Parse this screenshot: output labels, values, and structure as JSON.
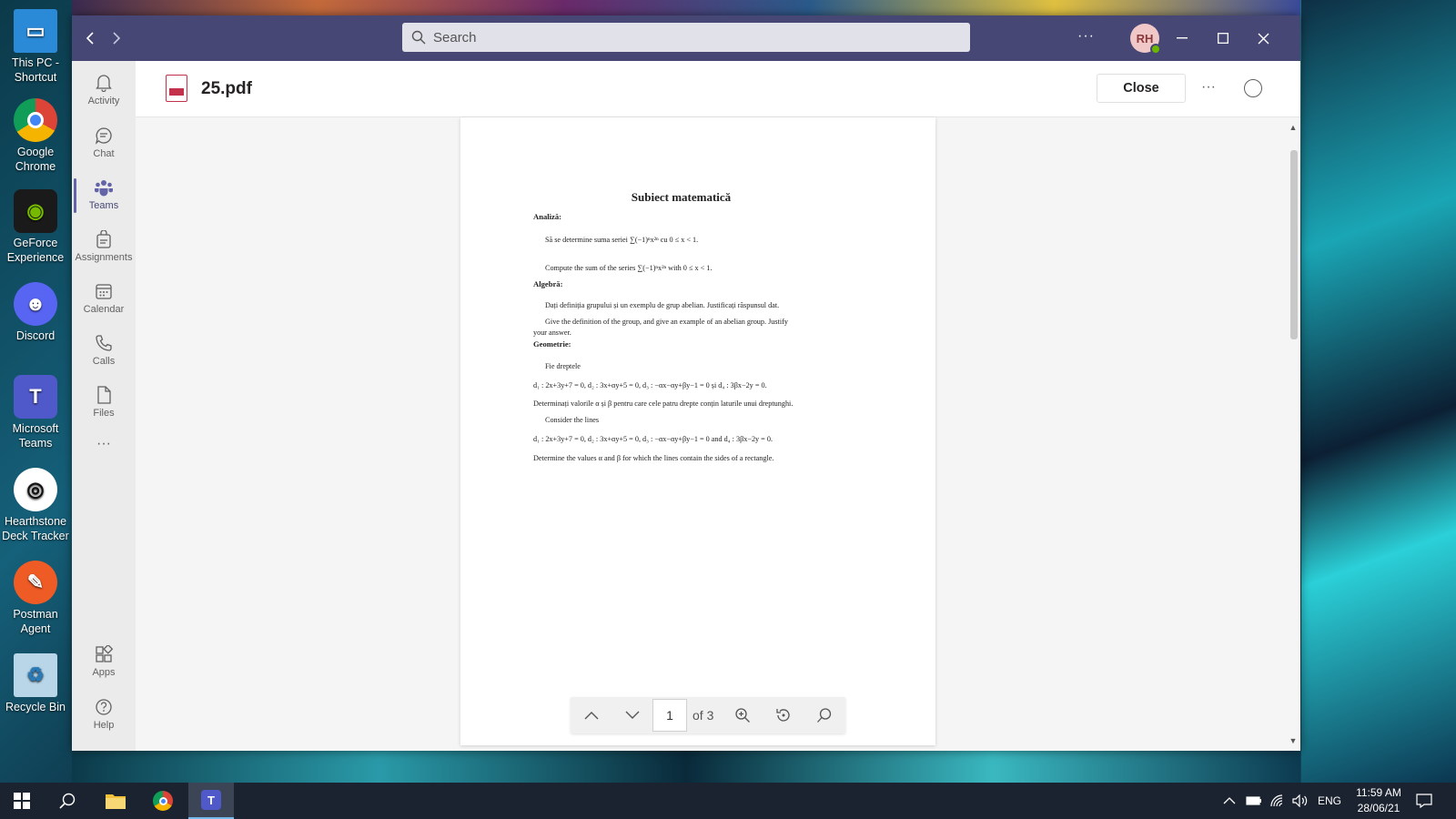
{
  "desktop": {
    "icons": [
      {
        "label": "This PC - Shortcut",
        "icon": "computer-icon"
      },
      {
        "label": "Google Chrome",
        "icon": "chrome-icon"
      },
      {
        "label": "GeForce Experience",
        "icon": "geforce-icon"
      },
      {
        "label": "Discord",
        "icon": "discord-icon"
      },
      {
        "label": "Microsoft Teams",
        "icon": "teams-icon"
      },
      {
        "label": "Hearthstone Deck Tracker",
        "icon": "hearthstone-icon"
      },
      {
        "label": "Postman Agent",
        "icon": "postman-icon"
      },
      {
        "label": "Recycle Bin",
        "icon": "recycle-bin-icon"
      }
    ]
  },
  "titlebar": {
    "search_placeholder": "Search",
    "more": "···",
    "avatar_initials": "RH",
    "accent": "#464775"
  },
  "rail": {
    "items": [
      {
        "label": "Activity",
        "icon": "bell-icon"
      },
      {
        "label": "Chat",
        "icon": "chat-icon"
      },
      {
        "label": "Teams",
        "icon": "teams-icon"
      },
      {
        "label": "Assignments",
        "icon": "assignments-icon"
      },
      {
        "label": "Calendar",
        "icon": "calendar-icon"
      },
      {
        "label": "Calls",
        "icon": "phone-icon"
      },
      {
        "label": "Files",
        "icon": "file-icon"
      }
    ],
    "more": "···",
    "bottom": [
      {
        "label": "Apps",
        "icon": "apps-icon"
      },
      {
        "label": "Help",
        "icon": "help-icon"
      }
    ]
  },
  "header": {
    "file_title": "25.pdf",
    "close_label": "Close",
    "more": "···"
  },
  "document": {
    "title": "Subiect matematică",
    "analiza": "Analiză:",
    "analiza_ro": "Să se determine suma seriei ∑(−1)ⁿx²ⁿ cu 0 ≤ x < 1.",
    "analiza_en": "Compute the sum of the series ∑(−1)ⁿx²ⁿ with 0 ≤ x < 1.",
    "algebra": "Algebră:",
    "algebra_ro": "Dați definiția grupului și un exemplu de grup abelian. Justificați răspunsul dat.",
    "algebra_en_1": "Give the definition of the group, and give an example of an abelian group. Justify",
    "algebra_en_2": "your answer.",
    "geometrie": "Geometrie:",
    "geo_ro_intro": "Fie dreptele",
    "geo_lines_ro": "d₁ : 2x+3y+7 = 0,   d₂ : 3x+αy+5 = 0,   d₃ : −αx−αy+βy−1 = 0   și   d₄ : 3βx−2y = 0.",
    "geo_ro_q": "Determinați valorile α și β pentru care cele patru drepte conțin laturile unui dreptunghi.",
    "geo_en_intro": "Consider the lines",
    "geo_lines_en": "d₁ : 2x+3y+7 = 0,   d₂ : 3x+αy+5 = 0,   d₃ : −αx−αy+βy−1 = 0   and   d₄ : 3βx−2y = 0.",
    "geo_en_q": "Determine the values α and β for which the lines contain the sides of a rectangle."
  },
  "pdf_toolbar": {
    "page_value": "1",
    "page_of": "of 3"
  },
  "taskbar": {
    "lang": "ENG",
    "time": "11:59 AM",
    "date": "28/06/21"
  }
}
